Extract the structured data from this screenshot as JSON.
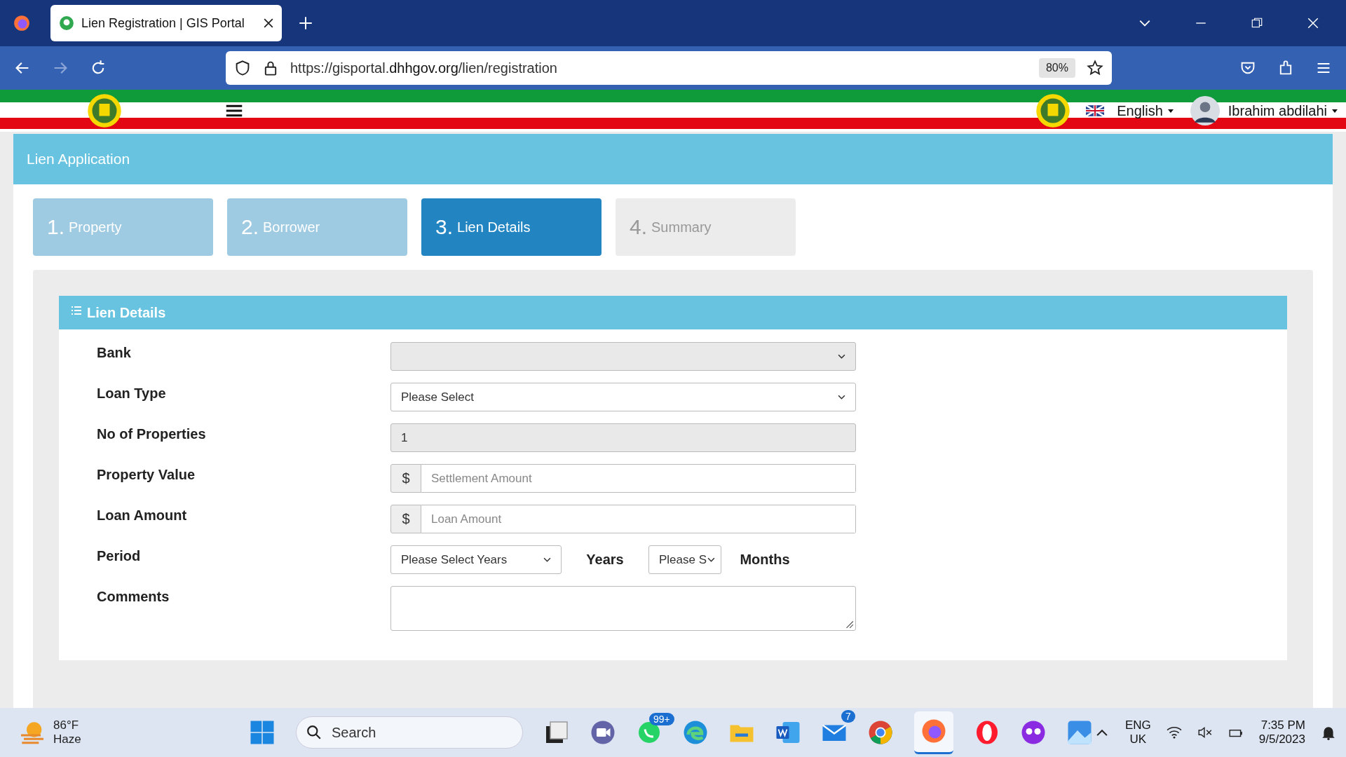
{
  "browser": {
    "tab_title": "Lien Registration | GIS Portal",
    "url_host": "https://gisportal.",
    "url_domain": "dhhgov.org",
    "url_path": "/lien/registration",
    "zoom": "80%"
  },
  "header": {
    "language": "English",
    "user": "Ibrahim abdilahi"
  },
  "page_title": "Lien Application",
  "steps": [
    {
      "number": "1.",
      "label": "Property",
      "selected": false
    },
    {
      "number": "2.",
      "label": "Borrower",
      "selected": false
    },
    {
      "number": "3.",
      "label": "Lien Details",
      "selected": true
    },
    {
      "number": "4.",
      "label": "Summary",
      "selected": false
    }
  ],
  "section": {
    "title": "Lien Details",
    "fields": [
      {
        "kind": "select",
        "label": "Bank",
        "disabled": true
      },
      {
        "kind": "select",
        "label": "Loan Type",
        "value": "Please Select",
        "disabled": false
      },
      {
        "kind": "text",
        "label": "No of Properties",
        "value": "1",
        "disabled": true
      },
      {
        "kind": "money",
        "label": "Property Value",
        "prefix": "$",
        "placeholder": "Settlement Amount",
        "disabled": false
      },
      {
        "kind": "money",
        "label": "Loan Amount",
        "prefix": "$",
        "placeholder": "Loan Amount",
        "disabled": false
      },
      {
        "kind": "period",
        "label": "Period",
        "years_value": "Please Select Years",
        "years_label": "Years",
        "months_value": "Please S",
        "months_label": "Months",
        "disabled": false
      },
      {
        "kind": "textarea",
        "label": "Comments",
        "disabled": false
      }
    ]
  },
  "taskbar": {
    "temperature": "86°F",
    "weather": "Haze",
    "search_placeholder": "Search",
    "whatsapp_badge": "99+",
    "mail_badge": "7",
    "lang_top": "ENG",
    "lang_bottom": "UK",
    "time": "7:35 PM",
    "date": "9/5/2023"
  }
}
